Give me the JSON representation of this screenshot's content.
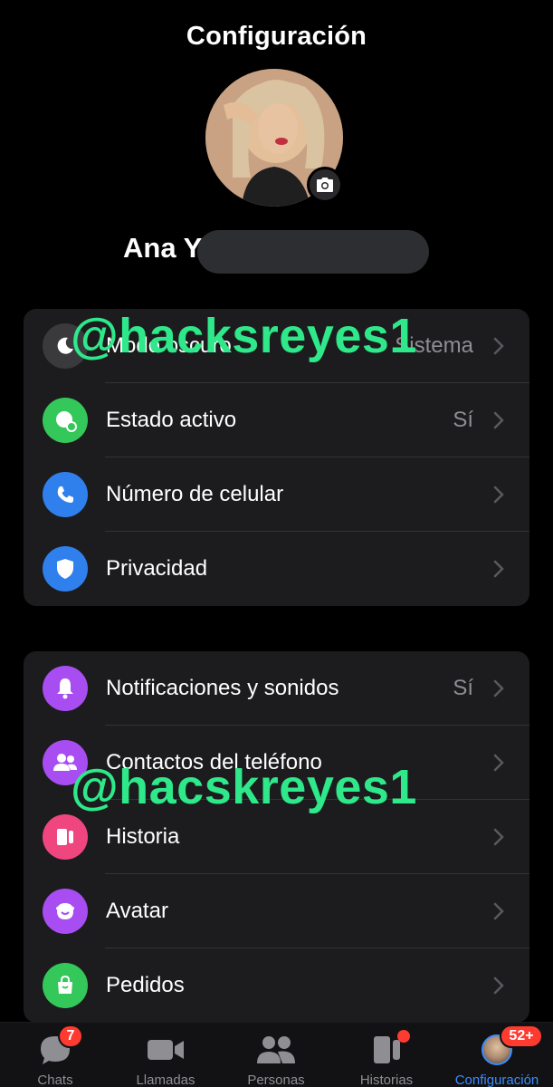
{
  "header": {
    "title": "Configuración"
  },
  "profile": {
    "name_visible": "Ana Y"
  },
  "group1": [
    {
      "icon": "moon-icon",
      "label": "Modo oscuro",
      "value": "Sistema",
      "color": "#3a3a3c"
    },
    {
      "icon": "active-status-icon",
      "label": "Estado activo",
      "value": "Sí",
      "color": "#34c759"
    },
    {
      "icon": "phone-icon",
      "label": "Número de celular",
      "value": "",
      "color": "#2f80ed"
    },
    {
      "icon": "shield-icon",
      "label": "Privacidad",
      "value": "",
      "color": "#2f80ed"
    }
  ],
  "group2": [
    {
      "icon": "bell-icon",
      "label": "Notificaciones y sonidos",
      "value": "Sí",
      "color": "#a74df2"
    },
    {
      "icon": "contacts-icon",
      "label": "Contactos del teléfono",
      "value": "",
      "color": "#a74df2"
    },
    {
      "icon": "story-icon",
      "label": "Historia",
      "value": "",
      "color": "#f0467f"
    },
    {
      "icon": "avatar-face-icon",
      "label": "Avatar",
      "value": "",
      "color": "#a74df2"
    },
    {
      "icon": "shopping-bag-icon",
      "label": "Pedidos",
      "value": "",
      "color": "#34c759"
    }
  ],
  "watermarks": [
    "@hacksreyes1",
    "@hacskreyes1"
  ],
  "tabbar": {
    "tabs": [
      {
        "label": "Chats",
        "icon": "chat-bubble-icon",
        "badge": "7"
      },
      {
        "label": "Llamadas",
        "icon": "video-camera-icon",
        "badge": ""
      },
      {
        "label": "Personas",
        "icon": "people-icon",
        "badge": ""
      },
      {
        "label": "Historias",
        "icon": "stories-icon",
        "badge": ""
      },
      {
        "label": "Configuración",
        "icon": "profile-avatar-icon",
        "badge": "52+"
      }
    ],
    "active_color": "#3b8cff",
    "badge_color": "#ff3b30"
  }
}
